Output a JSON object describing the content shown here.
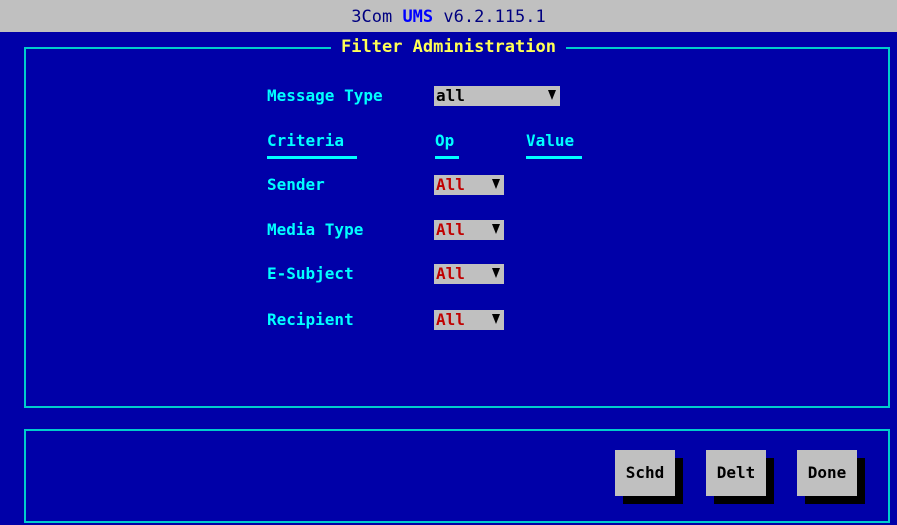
{
  "window": {
    "brand": "3Com",
    "product": "UMS",
    "version": "v6.2.115.1"
  },
  "panel": {
    "title": "Filter Administration"
  },
  "message_type": {
    "label": "Message Type",
    "value": "all"
  },
  "columns": {
    "criteria": "Criteria",
    "op": "Op",
    "value": "Value"
  },
  "criteria": [
    {
      "label": "Sender",
      "op": "All"
    },
    {
      "label": "Media Type",
      "op": "All"
    },
    {
      "label": "E-Subject",
      "op": "All"
    },
    {
      "label": "Recipient",
      "op": "All"
    }
  ],
  "buttons": {
    "schd": "Schd",
    "delt": "Delt",
    "done": "Done"
  },
  "colors": {
    "background": "#0000a8",
    "border": "#00cccc",
    "label": "#00ffff",
    "title": "#ffff55",
    "field": "#c0c0c0",
    "op_text": "#c00000"
  }
}
